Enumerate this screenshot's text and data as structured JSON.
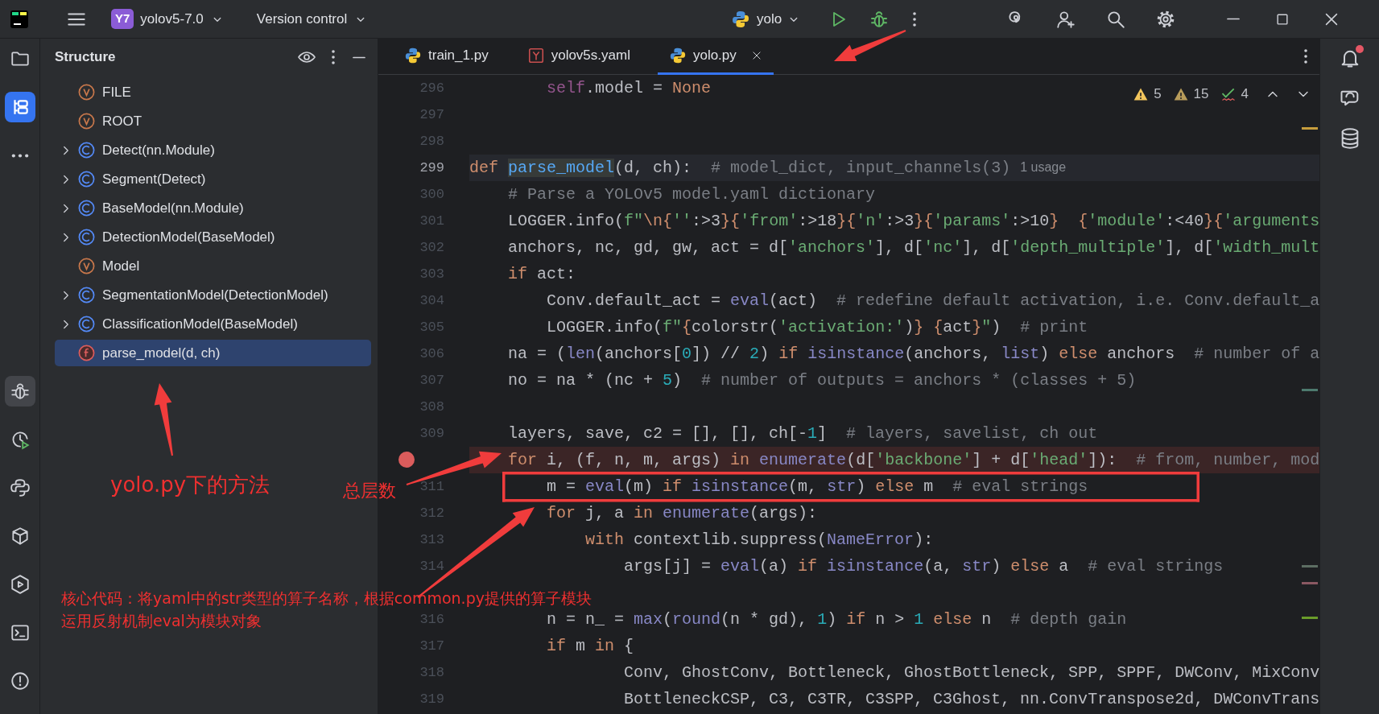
{
  "title_bar": {
    "project_badge": "Y7",
    "project": "yolov5-7.0",
    "vcs": "Version control",
    "run_config": "yolo"
  },
  "left_toolbar": {
    "top_items": [
      {
        "kind": "folder",
        "selected": false
      },
      {
        "kind": "structure",
        "selected": true
      },
      {
        "kind": "more",
        "selected": false
      }
    ],
    "bottom_items": [
      {
        "kind": "debug",
        "selected": true
      },
      {
        "kind": "profiler",
        "selected": false
      },
      {
        "kind": "python",
        "selected": false
      },
      {
        "kind": "packages",
        "selected": false
      },
      {
        "kind": "services",
        "selected": false
      },
      {
        "kind": "terminal",
        "selected": false
      },
      {
        "kind": "problems",
        "selected": false
      }
    ]
  },
  "structure": {
    "title": "Structure",
    "items": [
      {
        "label": "FILE",
        "kind": "variable",
        "expandable": false,
        "selected": false
      },
      {
        "label": "ROOT",
        "kind": "variable",
        "expandable": false,
        "selected": false
      },
      {
        "label": "Detect(nn.Module)",
        "kind": "class",
        "expandable": true,
        "selected": false
      },
      {
        "label": "Segment(Detect)",
        "kind": "class",
        "expandable": true,
        "selected": false
      },
      {
        "label": "BaseModel(nn.Module)",
        "kind": "class",
        "expandable": true,
        "selected": false
      },
      {
        "label": "DetectionModel(BaseModel)",
        "kind": "class",
        "expandable": true,
        "selected": false
      },
      {
        "label": "Model",
        "kind": "variable",
        "expandable": false,
        "selected": false
      },
      {
        "label": "SegmentationModel(DetectionModel)",
        "kind": "class",
        "expandable": true,
        "selected": false
      },
      {
        "label": "ClassificationModel(BaseModel)",
        "kind": "class",
        "expandable": true,
        "selected": false
      },
      {
        "label": "parse_model(d, ch)",
        "kind": "function",
        "expandable": false,
        "selected": true
      }
    ]
  },
  "editor": {
    "tabs": [
      {
        "label": "train_1.py",
        "kind": "python",
        "selected": false
      },
      {
        "label": "yolov5s.yaml",
        "kind": "yaml",
        "selected": false
      },
      {
        "label": "yolo.py",
        "kind": "python",
        "selected": true
      }
    ],
    "inspections": [
      {
        "kind": "warning",
        "count": "5"
      },
      {
        "kind": "weak",
        "count": "15"
      },
      {
        "kind": "typo",
        "count": "4"
      }
    ],
    "lines": [
      {
        "number": "296",
        "current": false,
        "breakpoint": false,
        "tokens": [
          {
            "kind": "self",
            "text": "        self"
          },
          {
            "kind": "plain",
            "text": ".model = "
          },
          {
            "kind": "keyword",
            "text": "None"
          }
        ]
      },
      {
        "number": "297",
        "current": false,
        "breakpoint": false
      },
      {
        "number": "298",
        "current": false,
        "breakpoint": false
      },
      {
        "number": "299",
        "current": true,
        "breakpoint": false,
        "hint": "1 usage",
        "tokens": [
          {
            "kind": "keyword",
            "text": "def "
          },
          {
            "kind": "definition",
            "text": "parse_model"
          },
          {
            "kind": "plain",
            "text": "(d, ch):  "
          },
          {
            "kind": "comment",
            "text": "# model_dict, input_channels(3)"
          }
        ]
      },
      {
        "number": "300",
        "current": false,
        "breakpoint": false,
        "tokens": [
          {
            "kind": "comment",
            "text": "    # Parse a YOLOv5 model.yaml dictionary"
          }
        ]
      },
      {
        "number": "301",
        "current": false,
        "breakpoint": false,
        "tokens": [
          {
            "kind": "plain",
            "text": "    LOGGER.info("
          },
          {
            "kind": "string",
            "text": "f\""
          },
          {
            "kind": "brace",
            "text": "\\n{"
          },
          {
            "kind": "string",
            "text": "''"
          },
          {
            "kind": "plain",
            "text": ":>3"
          },
          {
            "kind": "brace",
            "text": "}{"
          },
          {
            "kind": "string",
            "text": "'from'"
          },
          {
            "kind": "plain",
            "text": ":>18"
          },
          {
            "kind": "brace",
            "text": "}{"
          },
          {
            "kind": "string",
            "text": "'n'"
          },
          {
            "kind": "plain",
            "text": ":>3"
          },
          {
            "kind": "brace",
            "text": "}{"
          },
          {
            "kind": "string",
            "text": "'params'"
          },
          {
            "kind": "plain",
            "text": ":>10"
          },
          {
            "kind": "brace",
            "text": "}  {"
          },
          {
            "kind": "string",
            "text": "'module'"
          },
          {
            "kind": "plain",
            "text": ":<40"
          },
          {
            "kind": "brace",
            "text": "}{"
          },
          {
            "kind": "string",
            "text": "'arguments"
          }
        ]
      },
      {
        "number": "302",
        "current": false,
        "breakpoint": false,
        "tokens": [
          {
            "kind": "plain",
            "text": "    anchors, nc, gd, gw, act = d["
          },
          {
            "kind": "string",
            "text": "'anchors'"
          },
          {
            "kind": "plain",
            "text": "], d["
          },
          {
            "kind": "string",
            "text": "'nc'"
          },
          {
            "kind": "plain",
            "text": "], d["
          },
          {
            "kind": "string",
            "text": "'depth_multiple'"
          },
          {
            "kind": "plain",
            "text": "], d["
          },
          {
            "kind": "string",
            "text": "'width_mult"
          }
        ]
      },
      {
        "number": "303",
        "current": false,
        "breakpoint": false,
        "tokens": [
          {
            "kind": "keyword",
            "text": "    if "
          },
          {
            "kind": "plain",
            "text": "act:"
          }
        ]
      },
      {
        "number": "304",
        "current": false,
        "breakpoint": false,
        "tokens": [
          {
            "kind": "plain",
            "text": "        Conv.default_act = "
          },
          {
            "kind": "builtin",
            "text": "eval"
          },
          {
            "kind": "plain",
            "text": "(act)  "
          },
          {
            "kind": "comment",
            "text": "# redefine default activation, i.e. Conv.default_a"
          }
        ]
      },
      {
        "number": "305",
        "current": false,
        "breakpoint": false,
        "tokens": [
          {
            "kind": "plain",
            "text": "        LOGGER.info("
          },
          {
            "kind": "string",
            "text": "f\""
          },
          {
            "kind": "brace",
            "text": "{"
          },
          {
            "kind": "plain",
            "text": "colorstr("
          },
          {
            "kind": "string",
            "text": "'activation:'"
          },
          {
            "kind": "plain",
            "text": ")"
          },
          {
            "kind": "brace",
            "text": "} {"
          },
          {
            "kind": "plain",
            "text": "act"
          },
          {
            "kind": "brace",
            "text": "}"
          },
          {
            "kind": "string",
            "text": "\""
          },
          {
            "kind": "plain",
            "text": ")  "
          },
          {
            "kind": "comment",
            "text": "# print"
          }
        ]
      },
      {
        "number": "306",
        "current": false,
        "breakpoint": false,
        "tokens": [
          {
            "kind": "plain",
            "text": "    na = ("
          },
          {
            "kind": "builtin",
            "text": "len"
          },
          {
            "kind": "plain",
            "text": "(anchors["
          },
          {
            "kind": "number",
            "text": "0"
          },
          {
            "kind": "plain",
            "text": "]) // "
          },
          {
            "kind": "number",
            "text": "2"
          },
          {
            "kind": "plain",
            "text": ") "
          },
          {
            "kind": "keyword",
            "text": "if "
          },
          {
            "kind": "builtin",
            "text": "isinstance"
          },
          {
            "kind": "plain",
            "text": "(anchors, "
          },
          {
            "kind": "builtin",
            "text": "list"
          },
          {
            "kind": "plain",
            "text": ") "
          },
          {
            "kind": "keyword",
            "text": "else "
          },
          {
            "kind": "plain",
            "text": "anchors  "
          },
          {
            "kind": "comment",
            "text": "# number of a"
          }
        ]
      },
      {
        "number": "307",
        "current": false,
        "breakpoint": false,
        "tokens": [
          {
            "kind": "plain",
            "text": "    no = na * (nc + "
          },
          {
            "kind": "number",
            "text": "5"
          },
          {
            "kind": "plain",
            "text": ")  "
          },
          {
            "kind": "comment",
            "text": "# number of outputs = anchors * (classes + 5)"
          }
        ]
      },
      {
        "number": "308",
        "current": false,
        "breakpoint": false
      },
      {
        "number": "309",
        "current": false,
        "breakpoint": false,
        "tokens": [
          {
            "kind": "plain",
            "text": "    layers, save, c2 = [], [], ch[-"
          },
          {
            "kind": "number",
            "text": "1"
          },
          {
            "kind": "plain",
            "text": "]  "
          },
          {
            "kind": "comment",
            "text": "# layers, savelist, ch out"
          }
        ]
      },
      {
        "current": false,
        "breakpoint": true,
        "tokens": [
          {
            "kind": "keyword",
            "text": "    for "
          },
          {
            "kind": "plain",
            "text": "i, (f, n, m, args) "
          },
          {
            "kind": "keyword",
            "text": "in "
          },
          {
            "kind": "builtin",
            "text": "enumerate"
          },
          {
            "kind": "plain",
            "text": "(d["
          },
          {
            "kind": "string",
            "text": "'backbone'"
          },
          {
            "kind": "plain",
            "text": "] + d["
          },
          {
            "kind": "string",
            "text": "'head'"
          },
          {
            "kind": "plain",
            "text": "]):  "
          },
          {
            "kind": "comment",
            "text": "# from, number, mod"
          }
        ]
      },
      {
        "number": "311",
        "current": false,
        "breakpoint": false,
        "tokens": [
          {
            "kind": "plain",
            "text": "        m = "
          },
          {
            "kind": "builtin",
            "text": "eval"
          },
          {
            "kind": "plain",
            "text": "(m) "
          },
          {
            "kind": "keyword",
            "text": "if "
          },
          {
            "kind": "builtin",
            "text": "isinstance"
          },
          {
            "kind": "plain",
            "text": "(m, "
          },
          {
            "kind": "builtin",
            "text": "str"
          },
          {
            "kind": "plain",
            "text": ") "
          },
          {
            "kind": "keyword",
            "text": "else "
          },
          {
            "kind": "plain",
            "text": "m  "
          },
          {
            "kind": "comment",
            "text": "# eval strings"
          }
        ]
      },
      {
        "number": "312",
        "current": false,
        "breakpoint": false,
        "tokens": [
          {
            "kind": "keyword",
            "text": "        for "
          },
          {
            "kind": "plain",
            "text": "j, a "
          },
          {
            "kind": "keyword",
            "text": "in "
          },
          {
            "kind": "builtin",
            "text": "enumerate"
          },
          {
            "kind": "plain",
            "text": "(args):"
          }
        ]
      },
      {
        "number": "313",
        "current": false,
        "breakpoint": false,
        "tokens": [
          {
            "kind": "keyword",
            "text": "            with "
          },
          {
            "kind": "plain",
            "text": "contextlib.suppress("
          },
          {
            "kind": "builtin",
            "text": "NameError"
          },
          {
            "kind": "plain",
            "text": "):"
          }
        ]
      },
      {
        "number": "314",
        "current": false,
        "breakpoint": false,
        "tokens": [
          {
            "kind": "plain",
            "text": "                args[j] = "
          },
          {
            "kind": "builtin",
            "text": "eval"
          },
          {
            "kind": "plain",
            "text": "(a) "
          },
          {
            "kind": "keyword",
            "text": "if "
          },
          {
            "kind": "builtin",
            "text": "isinstance"
          },
          {
            "kind": "plain",
            "text": "(a, "
          },
          {
            "kind": "builtin",
            "text": "str"
          },
          {
            "kind": "plain",
            "text": ") "
          },
          {
            "kind": "keyword",
            "text": "else "
          },
          {
            "kind": "plain",
            "text": "a  "
          },
          {
            "kind": "comment",
            "text": "# eval strings"
          }
        ]
      },
      {
        "current": false,
        "breakpoint": false
      },
      {
        "number": "316",
        "current": false,
        "breakpoint": false,
        "tokens": [
          {
            "kind": "plain",
            "text": "        n = n_ = "
          },
          {
            "kind": "builtin",
            "text": "max"
          },
          {
            "kind": "plain",
            "text": "("
          },
          {
            "kind": "builtin",
            "text": "round"
          },
          {
            "kind": "plain",
            "text": "(n * gd), "
          },
          {
            "kind": "number",
            "text": "1"
          },
          {
            "kind": "plain",
            "text": ") "
          },
          {
            "kind": "keyword",
            "text": "if "
          },
          {
            "kind": "plain",
            "text": "n > "
          },
          {
            "kind": "number",
            "text": "1"
          },
          {
            "kind": "keyword",
            "text": " else "
          },
          {
            "kind": "plain",
            "text": "n  "
          },
          {
            "kind": "comment",
            "text": "# depth gain"
          }
        ]
      },
      {
        "number": "317",
        "current": false,
        "breakpoint": false,
        "tokens": [
          {
            "kind": "keyword",
            "text": "        if "
          },
          {
            "kind": "plain",
            "text": "m "
          },
          {
            "kind": "keyword",
            "text": "in "
          },
          {
            "kind": "plain",
            "text": "{"
          }
        ]
      },
      {
        "number": "318",
        "current": false,
        "breakpoint": false,
        "tokens": [
          {
            "kind": "plain",
            "text": "                Conv, GhostConv, Bottleneck, GhostBottleneck, SPP, SPPF, DWConv, MixConv"
          }
        ]
      },
      {
        "number": "319",
        "current": false,
        "breakpoint": false,
        "tokens": [
          {
            "kind": "plain",
            "text": "                BottleneckCSP, C3, C3TR, C3SPP, C3Ghost, nn.ConvTranspose2d, DWConvTrans"
          }
        ]
      }
    ]
  },
  "right_toolbar": {
    "unread_notifications": true
  },
  "annotations": [
    {
      "text": "yolo.py下的方法",
      "kind": "method"
    },
    {
      "text": "总层数",
      "kind": "layers"
    },
    {
      "text": "核心代码：将yaml中的str类型的算子名称，根据common.py提供的算子模块",
      "kind": "core"
    },
    {
      "text": "运用反射机制eval为模块对象",
      "kind": "core_cont"
    }
  ]
}
